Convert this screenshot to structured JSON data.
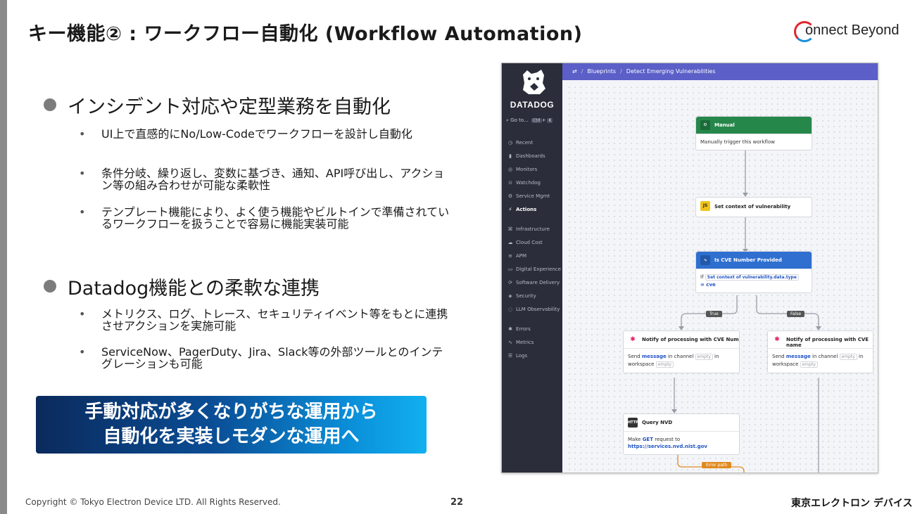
{
  "slide": {
    "title": "キー機能② : ワークフロー自動化 (Workflow Automation)",
    "logo_text": "onnect Beyond",
    "section1": {
      "heading": "インシデント対応や定型業務を自動化",
      "items": [
        "UI上で直感的にNo/Low-Codeでワークフローを設計し自動化",
        "条件分岐、繰り返し、変数に基づき、通知、API呼び出し、アクション等の組み合わせが可能な柔軟性",
        "テンプレート機能により、よく使う機能やビルトインで準備されているワークフローを扱うことで容易に機能実装可能"
      ]
    },
    "section2": {
      "heading": "Datadog機能との柔軟な連携",
      "items": [
        "メトリクス、ログ、トレース、セキュリティイベント等をもとに連携させアクションを実施可能",
        "ServiceNow、PagerDuty、Jira、Slack等の外部ツールとのインテグレーションも可能"
      ]
    },
    "banner": {
      "line1": "手動対応が多くなりがちな運用から",
      "line2": "自動化を実装しモダンな運用へ"
    },
    "footer": {
      "copyright": "Copyright © Tokyo Electron Device LTD. All Rights Reserved.",
      "page": "22",
      "brand": "東京エレクトロン デバイス"
    }
  },
  "screenshot": {
    "brand": "DATADOG",
    "goto": {
      "label": "Go to...",
      "kbd1": "Ctrl",
      "plus": "+",
      "kbd2": "K"
    },
    "nav": [
      {
        "label": "Recent",
        "icon": "clock-icon"
      },
      {
        "label": "Dashboards",
        "icon": "dashboard-icon"
      },
      {
        "label": "Monitors",
        "icon": "monitor-icon"
      },
      {
        "label": "Watchdog",
        "icon": "binoculars-icon"
      },
      {
        "label": "Service Mgmt",
        "icon": "gear-icon"
      },
      {
        "label": "Actions",
        "icon": "bolt-icon",
        "active": true
      },
      {
        "label": "Infrastructure",
        "icon": "network-icon"
      },
      {
        "label": "Cloud Cost",
        "icon": "cloud-icon"
      },
      {
        "label": "APM",
        "icon": "apm-icon"
      },
      {
        "label": "Digital Experience",
        "icon": "browser-icon"
      },
      {
        "label": "Software Delivery",
        "icon": "delivery-icon"
      },
      {
        "label": "Security",
        "icon": "shield-icon"
      },
      {
        "label": "LLM Observability",
        "icon": "llm-icon"
      },
      {
        "label": "Errors",
        "icon": "bug-icon"
      },
      {
        "label": "Metrics",
        "icon": "metrics-icon"
      },
      {
        "label": "Logs",
        "icon": "logs-icon"
      }
    ],
    "breadcrumb": {
      "root": "Blueprints",
      "current": "Detect Emerging Vulnerabilities"
    },
    "nodes": {
      "manual": {
        "title": "Manual",
        "body": "Manually trigger this workflow"
      },
      "js": {
        "icon": "JS",
        "title": "Set context of vulnerability"
      },
      "cond": {
        "title": "Is CVE Number Provided",
        "if": "If",
        "ref": "Set context of vulnerability.data.type",
        "eq": "= cve"
      },
      "notify_num": {
        "title": "Notify of processing with CVE Num",
        "send": "Send",
        "message": "message",
        "in_channel": "in channel",
        "empty1": "empty",
        "in": "in",
        "workspace": "workspace",
        "empty2": "empty"
      },
      "notify_name": {
        "title": "Notify of processing with CVE name",
        "send": "Send",
        "message": "message",
        "in_channel": "in channel",
        "empty1": "empty",
        "in": "in",
        "workspace": "workspace",
        "empty2": "empty"
      },
      "query": {
        "icon": "HTTP",
        "title": "Query NVD",
        "make": "Make",
        "method": "GET",
        "request_to": "request to",
        "url": "https://services.nvd.nist.gov"
      }
    },
    "branches": {
      "true": "True",
      "false": "False",
      "error": "Error path"
    }
  }
}
